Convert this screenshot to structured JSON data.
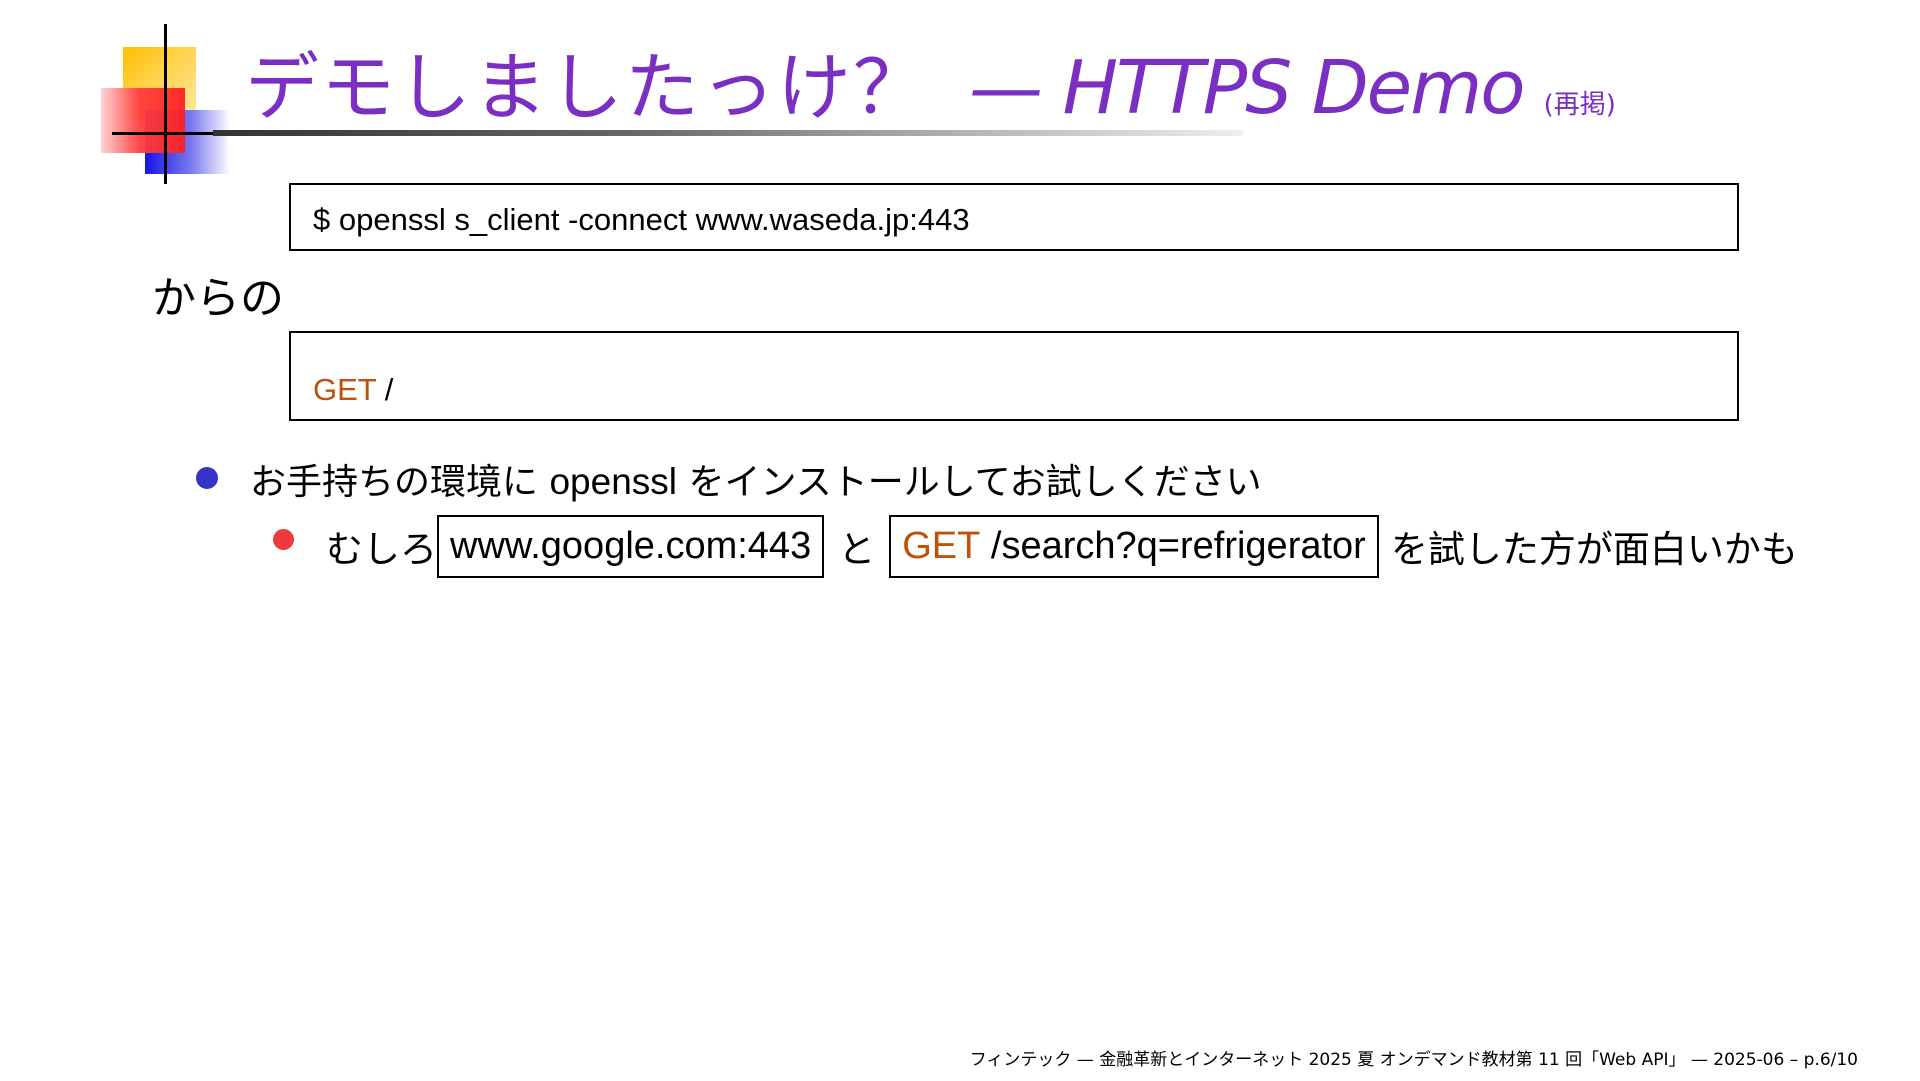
{
  "title": {
    "jp": "デモしましたっけ？",
    "en": "— HTTPS Demo",
    "note": "(再掲)"
  },
  "command_box": {
    "prompt": "$",
    "command": "openssl s_client -connect www.waseda.jp:443"
  },
  "kara_label": "からの",
  "request_box": {
    "method": "GET",
    "path": "/"
  },
  "bullets": [
    {
      "before": "お手持ちの環境に",
      "latin": "openssl",
      "after": "をインストールしてお試しください"
    }
  ],
  "sub_bullet": {
    "prefix": "むしろ",
    "host": "www.google.com:443",
    "connector": "と",
    "method": "GET",
    "path": "/search?q=refrigerator",
    "suffix": "を試した方が面白いかも"
  },
  "footer": "フィンテック — 金融革新とインターネット 2025 夏 オンデマンド教材第 11 回「Web API」 — 2025-06 – p.6/10",
  "colors": {
    "title": "#7a2fc2",
    "keyword": "#c0500a",
    "bullet_level1": "#3434c8",
    "bullet_level2": "#ee3a3a"
  }
}
